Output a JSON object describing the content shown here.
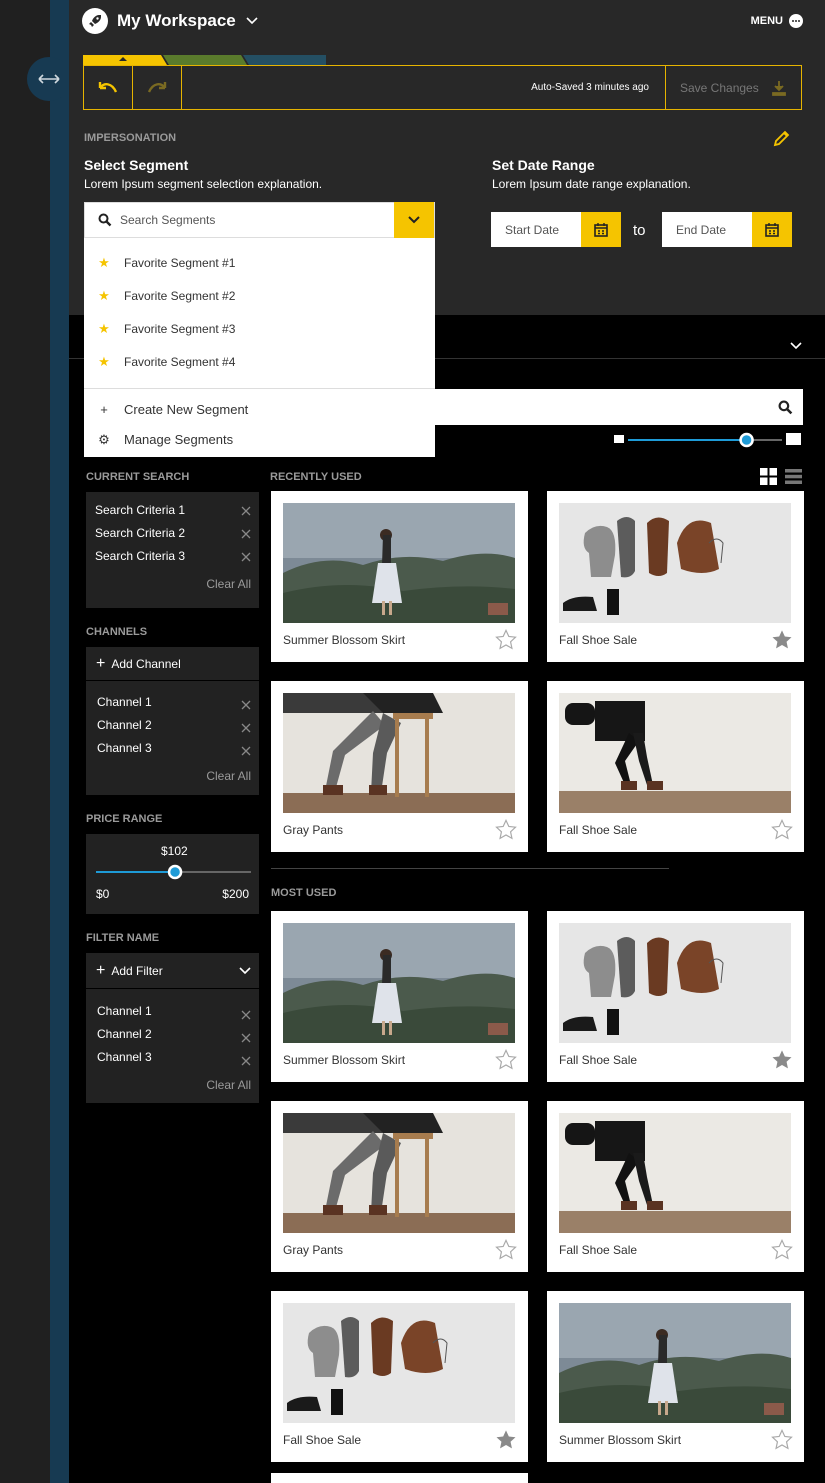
{
  "workspace": {
    "title": "My Workspace",
    "menu_label": "MENU"
  },
  "colors": {
    "accent": "#f5c400",
    "rail": "#173a52",
    "panel": "#282828",
    "progress_green": "#5a7b2c",
    "progress_teal": "#244f63",
    "slider_blue": "#1e9bd7"
  },
  "toolbar": {
    "autosave": "Auto-Saved 3 minutes ago",
    "save_label": "Save Changes"
  },
  "impersonation": {
    "label": "IMPERSONATION",
    "segment_title": "Select Segment",
    "segment_desc": "Lorem Ipsum segment selection explanation.",
    "search_placeholder": "Search Segments",
    "favorites": [
      "Favorite Segment #1",
      "Favorite Segment #2",
      "Favorite Segment #3",
      "Favorite Segment #4"
    ],
    "create_label": "Create New Segment",
    "manage_label": "Manage Segments",
    "date_title": "Set Date Range",
    "date_desc": "Lorem Ipsum date range explanation.",
    "start_placeholder": "Start Date",
    "end_placeholder": "End Date",
    "to_label": "to"
  },
  "sidebar": {
    "current_search": {
      "heading": "CURRENT SEARCH",
      "items": [
        "Search Criteria 1",
        "Search Criteria 2",
        "Search Criteria 3"
      ],
      "clear": "Clear All"
    },
    "channels": {
      "heading": "CHANNELS",
      "add": "Add Channel",
      "items": [
        "Channel 1",
        "Channel 2",
        "Channel 3"
      ],
      "clear": "Clear All"
    },
    "price_range": {
      "heading": "PRICE RANGE",
      "value": "$102",
      "min": "$0",
      "max": "$200",
      "fraction": 0.51
    },
    "filter_name": {
      "heading": "FILTER NAME",
      "add": "Add Filter",
      "items": [
        "Channel 1",
        "Channel 2",
        "Channel 3"
      ],
      "clear": "Clear All"
    }
  },
  "size_slider": {
    "fraction": 0.77
  },
  "sections": {
    "recent": {
      "heading": "RECENTLY USED",
      "cards": [
        {
          "caption": "Summer Blossom Skirt",
          "image": "landscape-girl",
          "starred": false
        },
        {
          "caption": "Fall Shoe Sale",
          "image": "shoes",
          "starred": true
        },
        {
          "caption": "Gray Pants",
          "image": "sitting-legs",
          "starred": false
        },
        {
          "caption": "Fall Shoe Sale",
          "image": "walking-bag",
          "starred": false
        }
      ]
    },
    "most": {
      "heading": "MOST USED",
      "cards": [
        {
          "caption": "Summer Blossom Skirt",
          "image": "landscape-girl",
          "starred": false
        },
        {
          "caption": "Fall Shoe Sale",
          "image": "shoes",
          "starred": true
        },
        {
          "caption": "Gray Pants",
          "image": "sitting-legs",
          "starred": false
        },
        {
          "caption": "Fall Shoe Sale",
          "image": "walking-bag",
          "starred": false
        },
        {
          "caption": "Fall Shoe Sale",
          "image": "shoes",
          "starred": true
        },
        {
          "caption": "Summer Blossom Skirt",
          "image": "landscape-girl",
          "starred": false
        }
      ]
    }
  }
}
